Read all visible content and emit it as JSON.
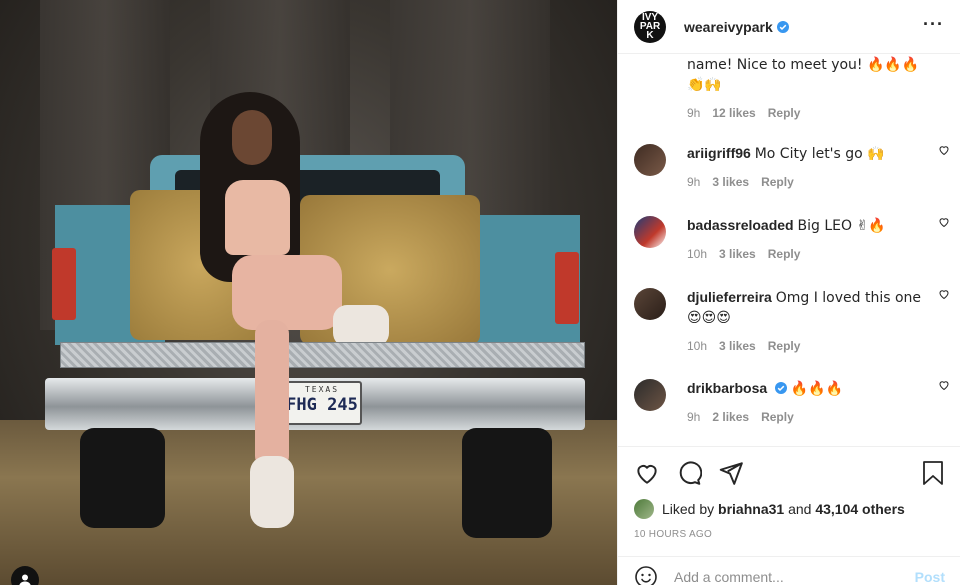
{
  "post": {
    "image_alt": "Woman sitting on hay bale in the bed of a blue pickup truck",
    "plate_state": "TEXAS",
    "plate_number": "FHG 245"
  },
  "header": {
    "username": "weareivypark",
    "avatar_text": "IVY PARK",
    "verified": true
  },
  "comments": [
    {
      "username": "",
      "text": "name! Nice to meet you! 🔥🔥🔥 👏🙌",
      "time": "9h",
      "likes": "12 likes",
      "reply": "Reply"
    },
    {
      "username": "ariigriff96",
      "text": "Mo City let's go 🙌",
      "time": "9h",
      "likes": "3 likes",
      "reply": "Reply"
    },
    {
      "username": "badassreloaded",
      "text": "Big LEO ✌🔥",
      "time": "10h",
      "likes": "3 likes",
      "reply": "Reply"
    },
    {
      "username": "djulieferreira",
      "text": "Omg I loved this one 😍😍😍",
      "time": "10h",
      "likes": "3 likes",
      "reply": "Reply"
    },
    {
      "username": "drikbarbosa",
      "text": "🔥🔥🔥",
      "time": "9h",
      "likes": "2 likes",
      "reply": "Reply",
      "verified": true
    }
  ],
  "likes_line": {
    "prefix": "Liked by",
    "user": "briahna31",
    "and": "and",
    "others": "43,104 others"
  },
  "timestamp": "10 HOURS AGO",
  "add_comment": {
    "placeholder": "Add a comment...",
    "post_label": "Post"
  },
  "icons": {
    "heart": "heart-icon",
    "comment": "comment-icon",
    "share": "share-icon",
    "save": "bookmark-icon",
    "more": "more-options-icon",
    "emoji": "smiley-icon"
  },
  "colors": {
    "verified_blue": "#3897f0",
    "post_button_disabled": "#b2dffc",
    "muted_text": "#8e8e8e"
  }
}
